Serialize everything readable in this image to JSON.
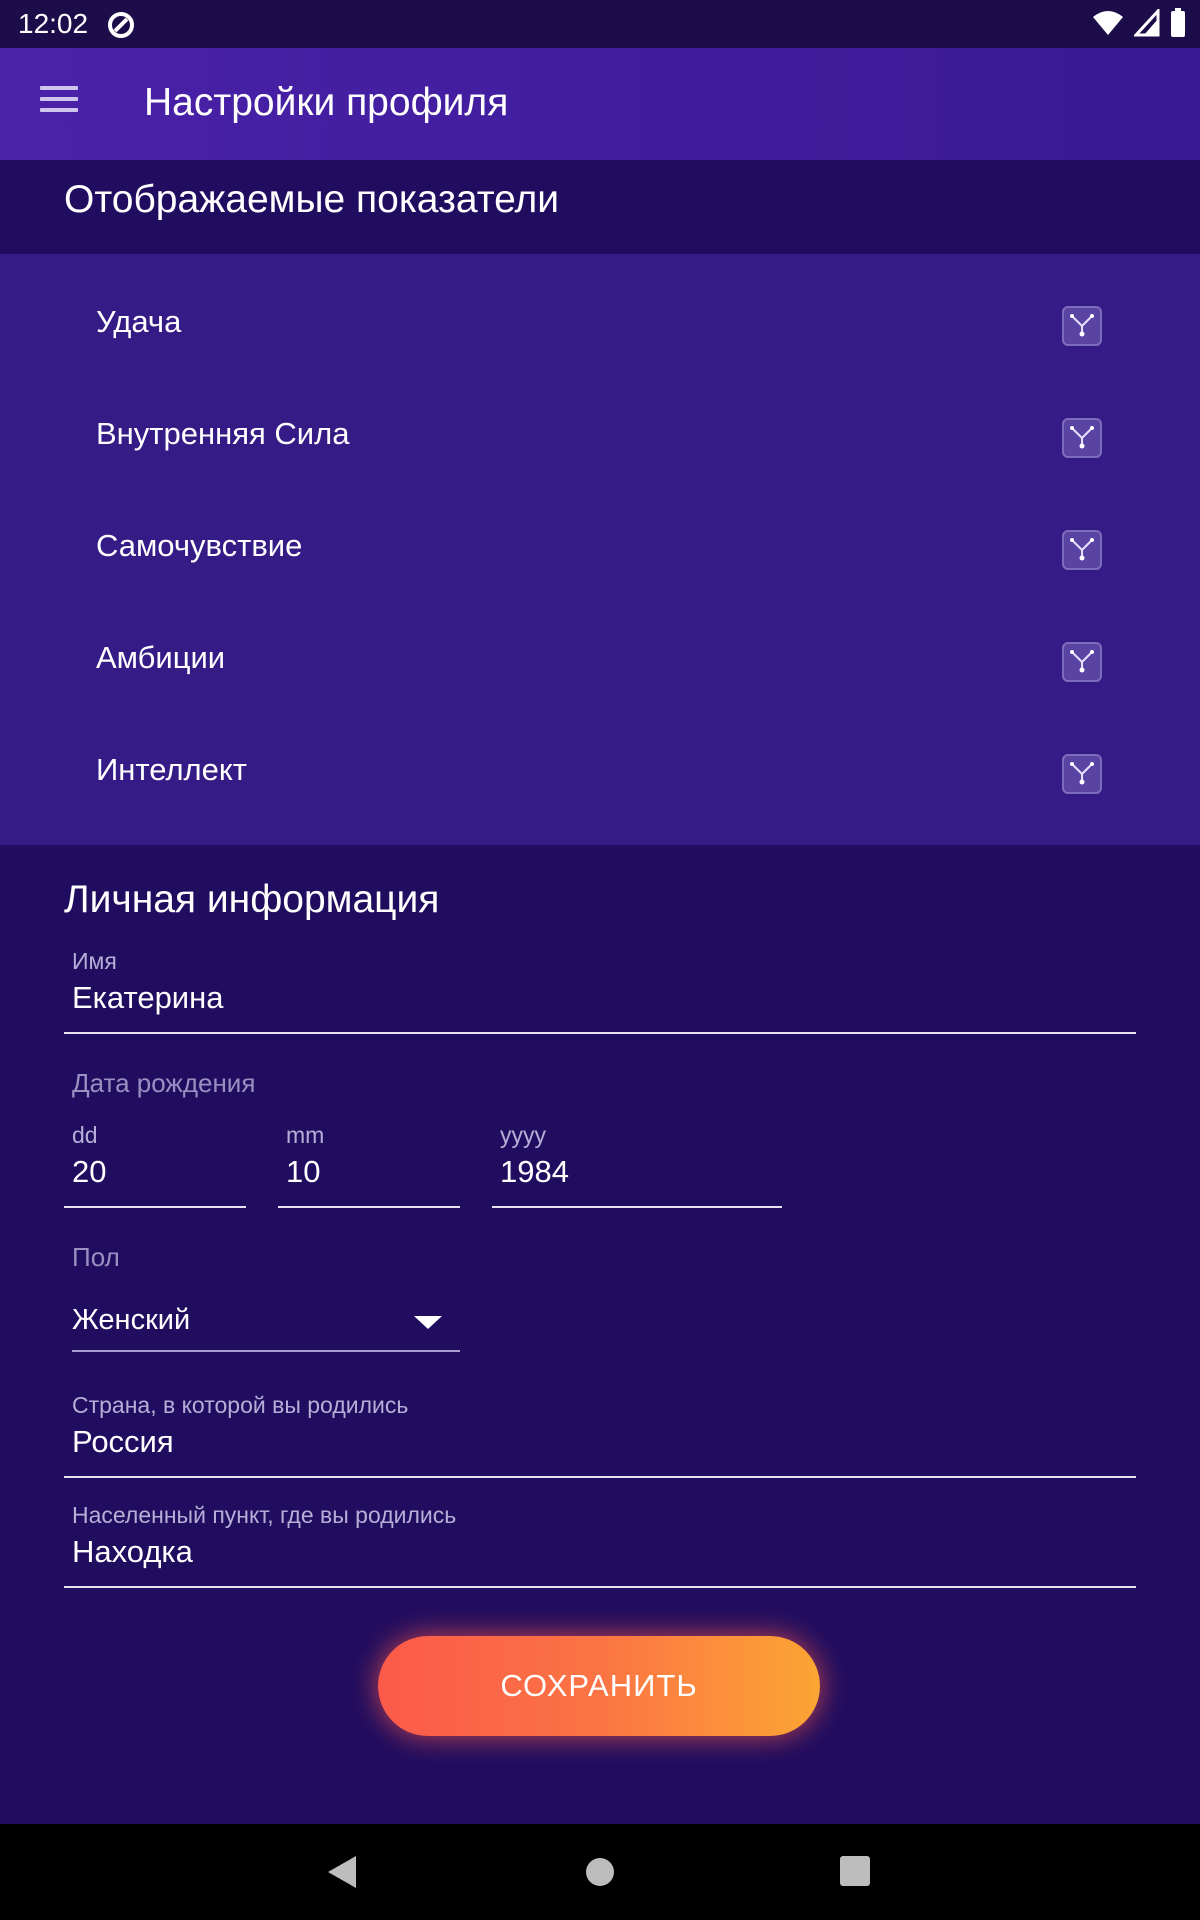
{
  "status_bar": {
    "time": "12:02"
  },
  "app_bar": {
    "title": "Настройки профиля"
  },
  "indicators": {
    "title": "Отображаемые показатели",
    "items": [
      {
        "label": "Удача",
        "checked": true
      },
      {
        "label": "Внутренняя Сила",
        "checked": true
      },
      {
        "label": "Самочувствие",
        "checked": true
      },
      {
        "label": "Амбиции",
        "checked": true
      },
      {
        "label": "Интеллект",
        "checked": true
      }
    ]
  },
  "personal": {
    "title": "Личная информация",
    "name": {
      "label": "Имя",
      "value": "Екатерина"
    },
    "birth_date": {
      "label": "Дата рождения",
      "day": {
        "hint": "dd",
        "value": "20"
      },
      "month": {
        "hint": "mm",
        "value": "10"
      },
      "year": {
        "hint": "yyyy",
        "value": "1984"
      }
    },
    "gender": {
      "label": "Пол",
      "value": "Женский"
    },
    "country": {
      "label": "Страна, в которой вы родились",
      "value": "Россия"
    },
    "city": {
      "label": "Населенный пункт, где вы родились",
      "value": "Находка"
    }
  },
  "save_button": {
    "label": "СОХРАНИТЬ"
  },
  "colors": {
    "accent_start": "#fb5a4a",
    "accent_end": "#fca534",
    "background": "#210d5f",
    "panel": "#351b86"
  }
}
